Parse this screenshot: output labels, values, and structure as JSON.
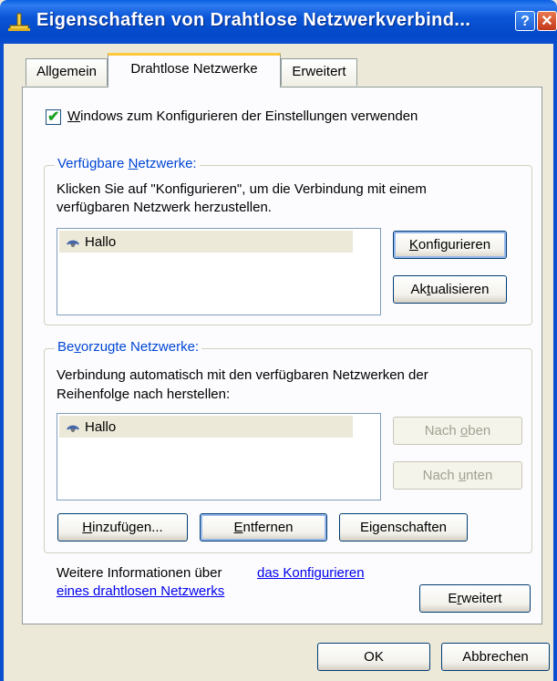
{
  "window": {
    "title": "Eigenschaften von Drahtlose Netzwerkverbind...",
    "help_label": "?",
    "close_label": "✕"
  },
  "tabs": [
    {
      "label": "Allgemein"
    },
    {
      "label": "Drahtlose Netzwerke",
      "active": true
    },
    {
      "label": "Erweitert"
    }
  ],
  "use_windows_checkbox": {
    "checked": true,
    "label_underline": "W",
    "label_rest": "indows zum Konfigurieren der Einstellungen verwenden"
  },
  "available": {
    "legend_pre": "Verfügbare ",
    "legend_u": "N",
    "legend_post": "etzwerke:",
    "description_line1": "Klicken Sie auf \"Konfigurieren\", um die Verbindung mit einem",
    "description_line2": "verfügbaren Netzwerk herzustellen.",
    "networks": [
      "Hallo"
    ],
    "configure_button": {
      "u": "K",
      "rest": "onfigurieren"
    },
    "refresh_button": {
      "pre": "Ak",
      "u": "t",
      "post": "ualisieren"
    }
  },
  "preferred": {
    "legend_pre": "Be",
    "legend_u": "v",
    "legend_post": "orzugte Netzwerke:",
    "description_line1": "Verbindung automatisch mit den verfügbaren Netzwerken der",
    "description_line2": "Reihenfolge nach herstellen:",
    "networks": [
      "Hallo"
    ],
    "move_up_button": {
      "pre": "Nach ",
      "u": "o",
      "post": "ben"
    },
    "move_down_button": {
      "pre": "Nach ",
      "u": "u",
      "post": "nten"
    },
    "add_button": {
      "u": "H",
      "rest": "inzufügen..."
    },
    "remove_button": {
      "u": "E",
      "rest": "ntfernen"
    },
    "properties_button": {
      "pre": "Ei",
      "u": "g",
      "post": "enschaften"
    }
  },
  "info": {
    "text": "Weitere Informationen über ",
    "link_line1": "das Konfigurieren",
    "link_line2": "eines drahtlosen Netzwerks"
  },
  "advanced_button": {
    "pre": "E",
    "u": "r",
    "post": "weitert"
  },
  "ok_button": "OK",
  "cancel_button": "Abbrechen"
}
